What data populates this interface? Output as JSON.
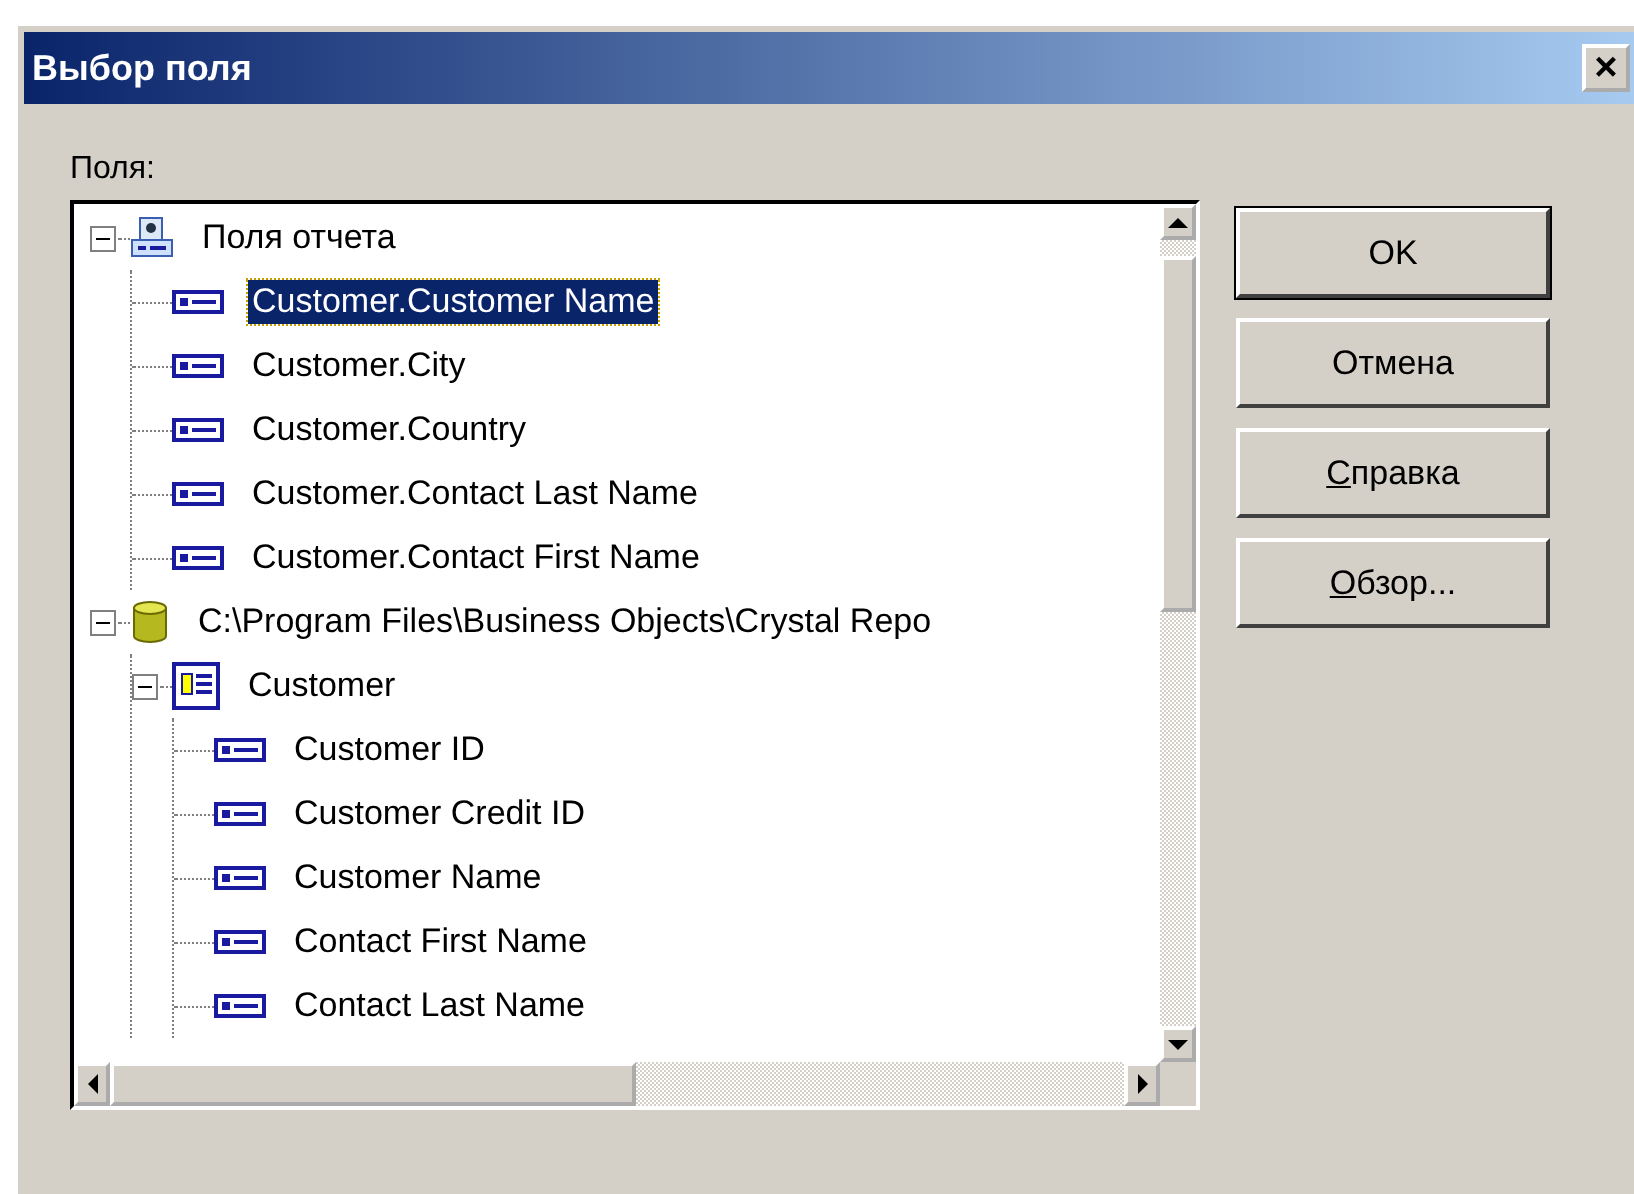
{
  "window": {
    "title": "Выбор поля",
    "close": "×"
  },
  "tree_label": "Поля:",
  "tree": [
    {
      "label": "Поля отчета",
      "kind": "report",
      "expanded": true,
      "selected": false,
      "children": [
        {
          "label": "Customer.Customer Name",
          "kind": "field",
          "selected": true
        },
        {
          "label": "Customer.City",
          "kind": "field",
          "selected": false
        },
        {
          "label": "Customer.Country",
          "kind": "field",
          "selected": false
        },
        {
          "label": "Customer.Contact Last Name",
          "kind": "field",
          "selected": false
        },
        {
          "label": "Customer.Contact First Name",
          "kind": "field",
          "selected": false
        }
      ]
    },
    {
      "label": "C:\\Program Files\\Business Objects\\Crystal Repo",
      "kind": "database",
      "expanded": true,
      "selected": false,
      "children": [
        {
          "label": "Customer",
          "kind": "table",
          "expanded": true,
          "selected": false,
          "children": [
            {
              "label": "Customer ID",
              "kind": "field",
              "selected": false
            },
            {
              "label": "Customer Credit ID",
              "kind": "field",
              "selected": false
            },
            {
              "label": "Customer Name",
              "kind": "field",
              "selected": false
            },
            {
              "label": "Contact First Name",
              "kind": "field",
              "selected": false
            },
            {
              "label": "Contact Last Name",
              "kind": "field",
              "selected": false
            }
          ]
        }
      ]
    }
  ],
  "buttons": [
    {
      "label": "OK",
      "default": true,
      "underline_first": false
    },
    {
      "label": "Отмена",
      "default": false,
      "underline_first": false
    },
    {
      "label": "Справка",
      "default": false,
      "underline_first": true
    },
    {
      "label": "Обзор...",
      "default": false,
      "underline_first": true
    }
  ]
}
